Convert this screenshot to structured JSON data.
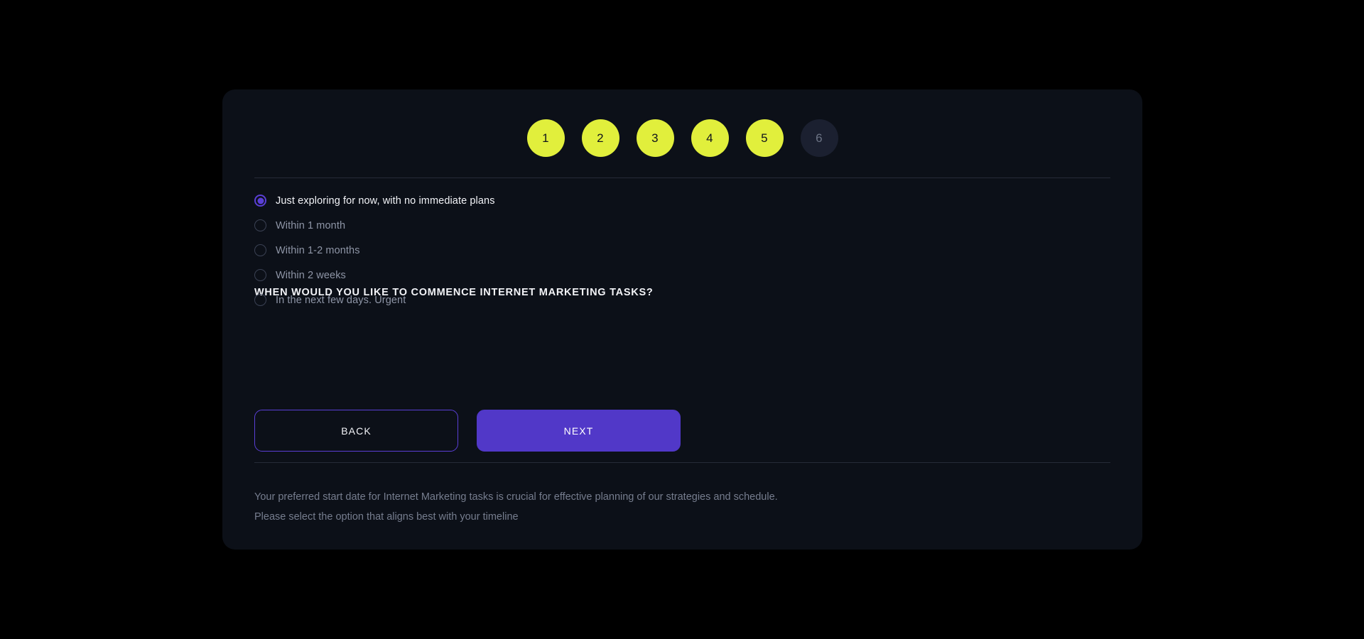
{
  "page": {
    "background_color": "#000000"
  },
  "card": {
    "background_color": "#0c1018"
  },
  "stepper": {
    "active_color": "#e1ef3c",
    "inactive_color": "#1b2030",
    "steps": [
      {
        "label": "1",
        "state": "active"
      },
      {
        "label": "2",
        "state": "active"
      },
      {
        "label": "3",
        "state": "active"
      },
      {
        "label": "4",
        "state": "active"
      },
      {
        "label": "5",
        "state": "active"
      },
      {
        "label": "6",
        "state": "inactive"
      }
    ]
  },
  "form": {
    "question": "WHEN WOULD YOU LIKE TO COMMENCE INTERNET MARKETING TASKS?",
    "options": [
      {
        "label": "Just exploring for now, with no immediate plans",
        "selected": true
      },
      {
        "label": "Within 1 month",
        "selected": false
      },
      {
        "label": "Within 1-2 months",
        "selected": false
      },
      {
        "label": "Within 2 weeks",
        "selected": false
      },
      {
        "label": "In the next few days. Urgent",
        "selected": false
      }
    ],
    "selected_option": "Just exploring for now, with no immediate plans"
  },
  "actions": {
    "back_label": "BACK",
    "next_label": "NEXT",
    "accent_color": "#5138c8",
    "outline_color": "#5a3fd6"
  },
  "note": {
    "text": "Your preferred start date for Internet Marketing tasks is crucial for effective planning of our strategies and schedule. Please select the option that aligns best with your timeline"
  }
}
